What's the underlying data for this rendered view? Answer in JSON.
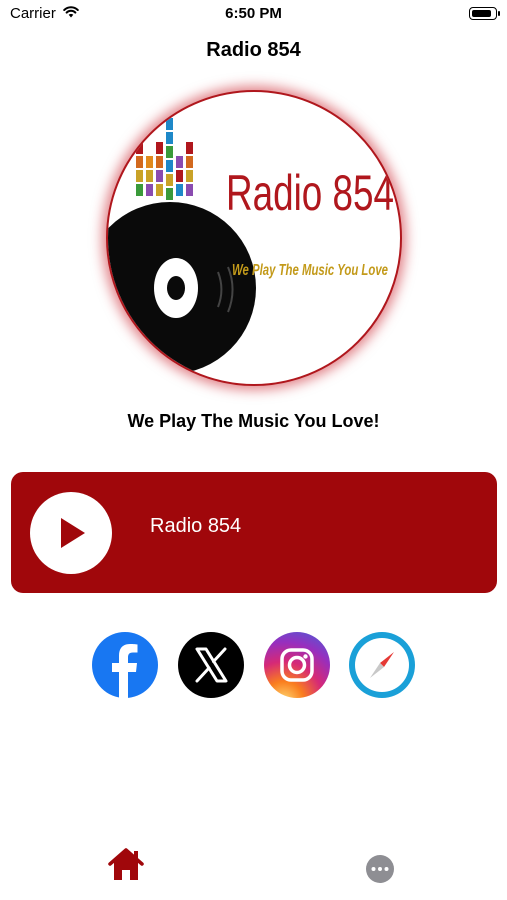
{
  "status_bar": {
    "carrier": "Carrier",
    "time": "6:50 PM",
    "battery_level": 0.95
  },
  "nav": {
    "title": "Radio 854"
  },
  "logo": {
    "name": "Radio 854",
    "tagline": "We Play The Music You Love"
  },
  "slogan": "We Play The Music You Love!",
  "player": {
    "station": "Radio 854",
    "state": "paused"
  },
  "social": [
    {
      "name": "facebook",
      "icon": "facebook-icon"
    },
    {
      "name": "x",
      "icon": "x-icon"
    },
    {
      "name": "instagram",
      "icon": "instagram-icon"
    },
    {
      "name": "website",
      "icon": "compass-icon"
    }
  ],
  "tabs": [
    {
      "name": "home",
      "icon": "home-icon",
      "selected": true
    },
    {
      "name": "more",
      "icon": "more-icon",
      "selected": false
    }
  ],
  "colors": {
    "brand": "#a0070b",
    "text": "#000000",
    "background": "#ffffff",
    "tab_inactive": "#8e8e93"
  }
}
